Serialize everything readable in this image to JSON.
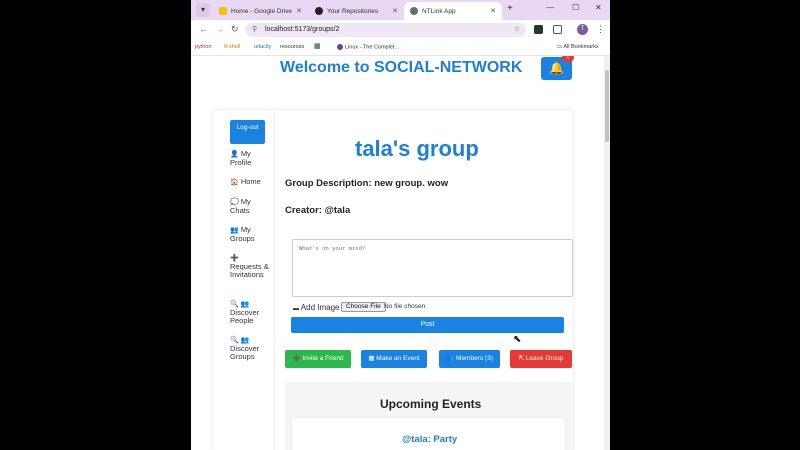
{
  "browser": {
    "tabs": [
      {
        "label": "Home - Google Drive",
        "color": "#fbbc04"
      },
      {
        "label": "Your Repositories",
        "color": "#222222"
      },
      {
        "label": "NTLink App",
        "color": "#6b6b6b"
      }
    ],
    "url": "localhost:5173/groups/2",
    "bookmarks": [
      "python",
      "0-shell",
      "udacity",
      "resources",
      "Linux - The Complet...",
      "All Bookmarks"
    ],
    "profile_initial": "T"
  },
  "header": {
    "title": "Welcome to SOCIAL-NETWORK",
    "notification_icon": "bell-icon",
    "badge": "1"
  },
  "sidebar": {
    "logout": "Log-out",
    "items": [
      {
        "icon": "👤",
        "label": "My Profile"
      },
      {
        "icon": "🏠",
        "label": "Home"
      },
      {
        "icon": "💭",
        "label": "My Chats"
      },
      {
        "icon": "👥",
        "label": "My Groups"
      },
      {
        "icon": "➕",
        "label": "Requests & Invitations"
      },
      {
        "icon": "🔍 👥",
        "label": "Discover People"
      },
      {
        "icon": "🔍 👥",
        "label": "Discover Groups"
      }
    ]
  },
  "group": {
    "title": "tala's group",
    "description": "Group Description: new group. wow",
    "creator": "Creator: @tala"
  },
  "composer": {
    "placeholder": "What's on your mind?",
    "add_image": "Add Image",
    "choose_file": "Choose File",
    "file_status": "No file chosen",
    "post": "Post"
  },
  "actions": {
    "invite": "Invite a Friend",
    "event": "Make an Event",
    "members": "Members (3)",
    "leave": "Leave Group"
  },
  "events": {
    "title": "Upcoming Events",
    "items": [
      {
        "name": "@tala: Party"
      }
    ]
  },
  "colors": {
    "primary": "#1a82e2",
    "success": "#2db84d",
    "danger": "#e53935"
  }
}
